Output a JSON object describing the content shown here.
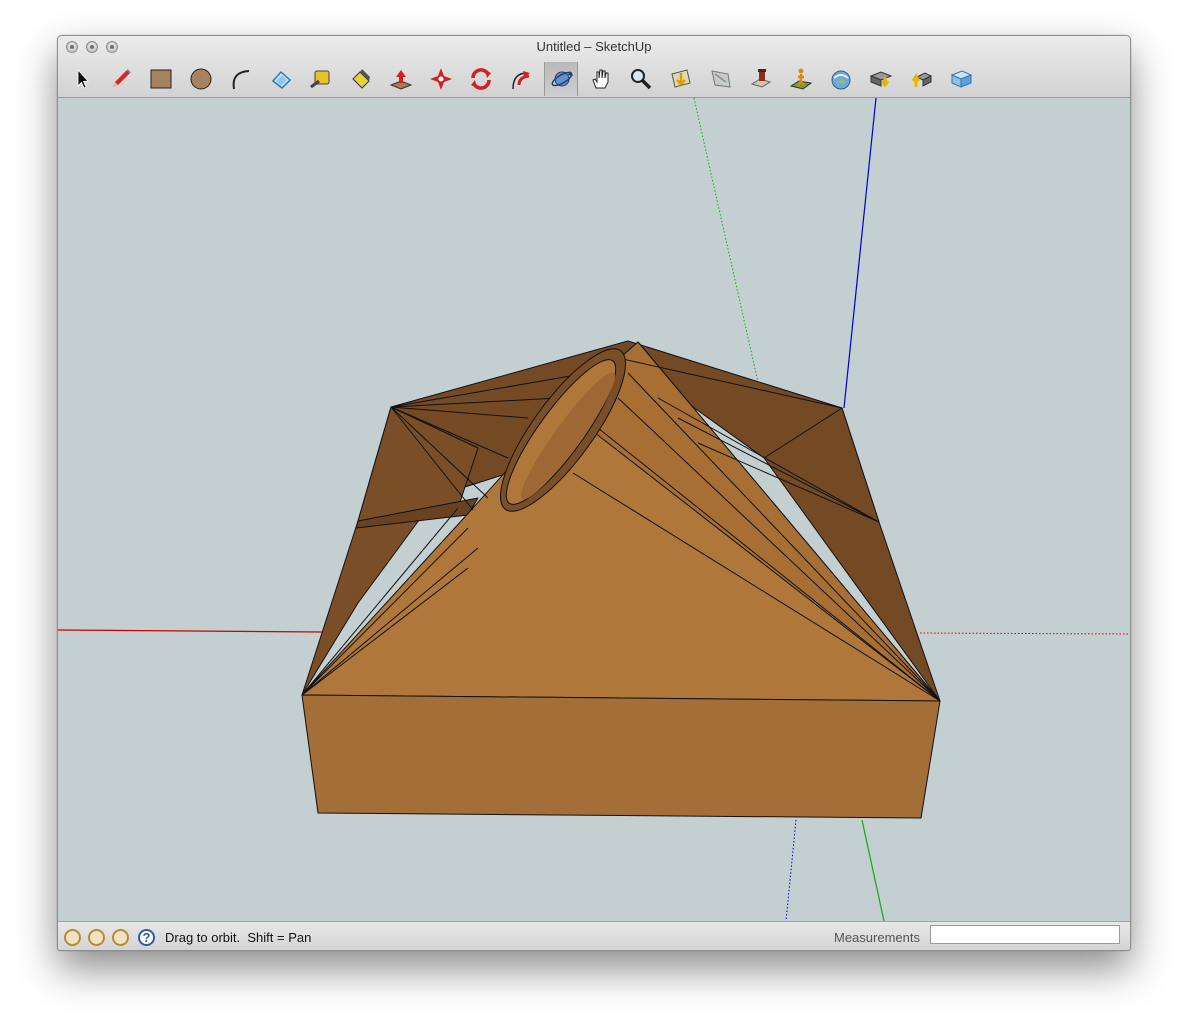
{
  "window": {
    "title": "Untitled – SketchUp"
  },
  "toolbar": {
    "tools": [
      {
        "name": "select",
        "icon": "arrow-icon"
      },
      {
        "name": "pencil",
        "icon": "pencil-icon"
      },
      {
        "name": "rectangle",
        "icon": "rectangle-icon"
      },
      {
        "name": "circle",
        "icon": "circle-icon"
      },
      {
        "name": "arc",
        "icon": "arc-icon"
      },
      {
        "name": "eraser",
        "icon": "eraser-icon"
      },
      {
        "name": "tape-measure",
        "icon": "tape-measure-icon"
      },
      {
        "name": "paint-bucket",
        "icon": "paint-bucket-icon"
      },
      {
        "name": "push-pull",
        "icon": "push-pull-icon"
      },
      {
        "name": "move",
        "icon": "move-icon"
      },
      {
        "name": "rotate",
        "icon": "rotate-icon"
      },
      {
        "name": "follow-me",
        "icon": "follow-me-icon"
      },
      {
        "name": "orbit",
        "icon": "orbit-icon",
        "active": true
      },
      {
        "name": "pan",
        "icon": "hand-icon"
      },
      {
        "name": "zoom",
        "icon": "magnifier-icon"
      },
      {
        "name": "zoom-extents",
        "icon": "zoom-extents-icon"
      },
      {
        "name": "previous-view",
        "icon": "previous-view-icon"
      },
      {
        "name": "position-camera",
        "icon": "position-camera-icon"
      },
      {
        "name": "walk",
        "icon": "walk-icon"
      },
      {
        "name": "add-location",
        "icon": "globe-icon"
      },
      {
        "name": "get-models",
        "icon": "get-models-icon"
      },
      {
        "name": "share-model",
        "icon": "share-model-icon"
      },
      {
        "name": "extension-warehouse",
        "icon": "extension-warehouse-icon"
      }
    ]
  },
  "status": {
    "message": "Drag to orbit.  Shift = Pan",
    "measurements_label": "Measurements",
    "measurements_value": ""
  },
  "colors": {
    "viewport_bg": "#c4cfd2",
    "axis_red": "#cc0000",
    "axis_green": "#11aa11",
    "axis_blue": "#0000cc",
    "model_light": "#b0773b",
    "model_dark": "#744a25"
  }
}
